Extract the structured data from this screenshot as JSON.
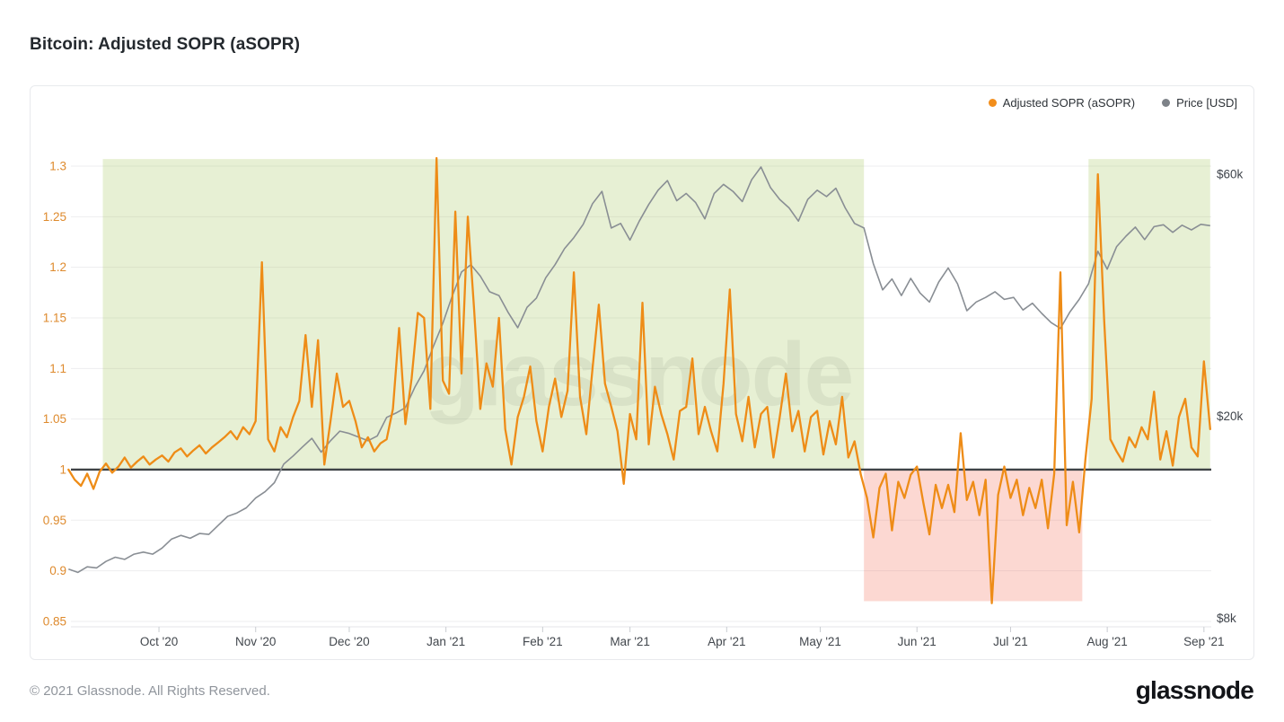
{
  "page": {
    "title": "Bitcoin: Adjusted SOPR (aSOPR)",
    "footer_copyright": "© 2021 Glassnode. All Rights Reserved.",
    "brand_logo": "glassnode",
    "watermark": "glassnode"
  },
  "legend": {
    "items": [
      {
        "label": "Adjusted SOPR (aSOPR)",
        "color": "#f28e1c"
      },
      {
        "label": "Price [USD]",
        "color": "#7d8288"
      }
    ]
  },
  "colors": {
    "asopr_line": "#ee8c17",
    "price_line": "#898e94",
    "baseline": "#3f4347",
    "grid": "#ededef",
    "axis_left_text": "#de8a2d",
    "axis_right_text": "#3f444b",
    "axis_x_text": "#42474d",
    "green_band": "rgba(166,198,95,0.27)",
    "red_band": "rgba(242,101,76,0.25)",
    "watermark": "rgba(128,138,118,0.30)"
  },
  "chart_data": {
    "type": "line",
    "title": "Bitcoin: Adjusted SOPR (aSOPR)",
    "day0_date": "2020-09-02",
    "x_axis": {
      "ticks": [
        {
          "label": "Oct '20",
          "day": 29
        },
        {
          "label": "Nov '20",
          "day": 60
        },
        {
          "label": "Dec '20",
          "day": 90
        },
        {
          "label": "Jan '21",
          "day": 121
        },
        {
          "label": "Feb '21",
          "day": 152
        },
        {
          "label": "Mar '21",
          "day": 180
        },
        {
          "label": "Apr '21",
          "day": 211
        },
        {
          "label": "May '21",
          "day": 241
        },
        {
          "label": "Jun '21",
          "day": 272
        },
        {
          "label": "Jul '21",
          "day": 302
        },
        {
          "label": "Aug '21",
          "day": 333
        },
        {
          "label": "Sep '21",
          "day": 364
        }
      ]
    },
    "y_axis_left": {
      "series": "Adjusted SOPR (aSOPR)",
      "ticks": [
        1.3,
        1.25,
        1.2,
        1.15,
        1.1,
        1.05,
        1,
        0.95,
        0.9,
        0.85
      ],
      "range": [
        0.845,
        1.308
      ],
      "scale": "linear"
    },
    "y_axis_right": {
      "series": "Price [USD]",
      "scale": "log",
      "ticks": [
        {
          "label": "$60k",
          "value_k": 60
        },
        {
          "label": "$20k",
          "value_k": 20
        },
        {
          "label": "$8k",
          "value_k": 8
        }
      ]
    },
    "baseline": {
      "value": 1.0
    },
    "bands": [
      {
        "kind": "asopr-above-1",
        "from_day": 11,
        "to_day": 255,
        "v_from": 1.0,
        "v_to": 1.307,
        "color_key": "green_band"
      },
      {
        "kind": "asopr-below-1",
        "from_day": 255,
        "to_day": 325,
        "v_from": 0.87,
        "v_to": 1.0,
        "color_key": "red_band"
      },
      {
        "kind": "asopr-above-1",
        "from_day": 327,
        "to_day": 366,
        "v_from": 1.0,
        "v_to": 1.307,
        "color_key": "green_band"
      }
    ],
    "series": [
      {
        "name": "Adjusted SOPR (aSOPR)",
        "axis": "left",
        "color": "#ee8c17",
        "start_day": 0,
        "sample_interval_days": 2,
        "values": [
          1.0,
          0.99,
          0.984,
          0.996,
          0.981,
          0.998,
          1.006,
          0.997,
          1.003,
          1.012,
          1.002,
          1.008,
          1.013,
          1.005,
          1.01,
          1.014,
          1.008,
          1.017,
          1.021,
          1.013,
          1.019,
          1.024,
          1.016,
          1.022,
          1.027,
          1.032,
          1.038,
          1.03,
          1.042,
          1.035,
          1.048,
          1.205,
          1.03,
          1.018,
          1.042,
          1.032,
          1.052,
          1.068,
          1.133,
          1.062,
          1.128,
          1.005,
          1.048,
          1.095,
          1.062,
          1.068,
          1.048,
          1.022,
          1.032,
          1.018,
          1.026,
          1.03,
          1.06,
          1.14,
          1.045,
          1.09,
          1.155,
          1.15,
          1.06,
          1.308,
          1.088,
          1.075,
          1.255,
          1.095,
          1.25,
          1.16,
          1.06,
          1.105,
          1.082,
          1.15,
          1.04,
          1.005,
          1.052,
          1.072,
          1.102,
          1.048,
          1.018,
          1.062,
          1.09,
          1.052,
          1.078,
          1.195,
          1.072,
          1.035,
          1.1,
          1.163,
          1.085,
          1.062,
          1.038,
          0.986,
          1.055,
          1.03,
          1.165,
          1.025,
          1.082,
          1.055,
          1.035,
          1.01,
          1.058,
          1.062,
          1.11,
          1.035,
          1.062,
          1.038,
          1.018,
          1.085,
          1.178,
          1.055,
          1.028,
          1.072,
          1.022,
          1.055,
          1.062,
          1.012,
          1.052,
          1.095,
          1.038,
          1.058,
          1.018,
          1.052,
          1.058,
          1.015,
          1.048,
          1.025,
          1.072,
          1.012,
          1.028,
          0.995,
          0.972,
          0.933,
          0.982,
          0.996,
          0.94,
          0.988,
          0.972,
          0.995,
          1.003,
          0.968,
          0.936,
          0.985,
          0.962,
          0.985,
          0.958,
          1.036,
          0.97,
          0.988,
          0.955,
          0.99,
          0.868,
          0.975,
          1.003,
          0.972,
          0.99,
          0.955,
          0.982,
          0.962,
          0.99,
          0.942,
          0.996,
          1.195,
          0.945,
          0.988,
          0.938,
          1.01,
          1.07,
          1.292,
          1.148,
          1.03,
          1.018,
          1.008,
          1.032,
          1.022,
          1.042,
          1.03,
          1.077,
          1.01,
          1.038,
          1.004,
          1.052,
          1.07,
          1.022,
          1.013,
          1.107,
          1.04
        ]
      },
      {
        "name": "Price [USD]",
        "axis": "right",
        "color": "#898e94",
        "unit": "USD thousands",
        "start_day": 0,
        "sample_interval_days": 3,
        "values": [
          10.0,
          9.85,
          10.1,
          10.05,
          10.35,
          10.55,
          10.45,
          10.7,
          10.8,
          10.7,
          11.0,
          11.45,
          11.65,
          11.5,
          11.75,
          11.7,
          12.2,
          12.7,
          12.9,
          13.2,
          13.8,
          14.2,
          14.8,
          16.1,
          16.7,
          17.4,
          18.1,
          17.0,
          17.9,
          18.7,
          18.5,
          18.2,
          17.9,
          18.3,
          19.9,
          20.3,
          20.8,
          22.8,
          24.6,
          27.5,
          30.5,
          34.5,
          38.5,
          39.8,
          37.8,
          35.2,
          34.6,
          32.0,
          29.9,
          32.8,
          34.2,
          37.5,
          39.8,
          42.8,
          45.0,
          47.8,
          52.5,
          55.5,
          47.0,
          48.0,
          44.5,
          48.5,
          52.3,
          55.8,
          58.3,
          53.2,
          55.0,
          52.8,
          49.0,
          55.0,
          57.3,
          55.5,
          53.0,
          58.5,
          62.0,
          56.5,
          53.5,
          51.5,
          48.5,
          53.5,
          55.8,
          54.2,
          56.3,
          51.5,
          48.0,
          47.0,
          40.0,
          35.5,
          37.3,
          34.6,
          37.4,
          35.0,
          33.6,
          36.8,
          39.2,
          36.5,
          32.3,
          33.6,
          34.3,
          35.2,
          34.0,
          34.3,
          32.4,
          33.4,
          31.9,
          30.6,
          29.8,
          32.1,
          34.0,
          36.5,
          42.3,
          39.0,
          43.2,
          45.3,
          47.2,
          44.6,
          47.3,
          47.7,
          46.1,
          47.6,
          46.6,
          47.8,
          47.5
        ]
      }
    ]
  }
}
